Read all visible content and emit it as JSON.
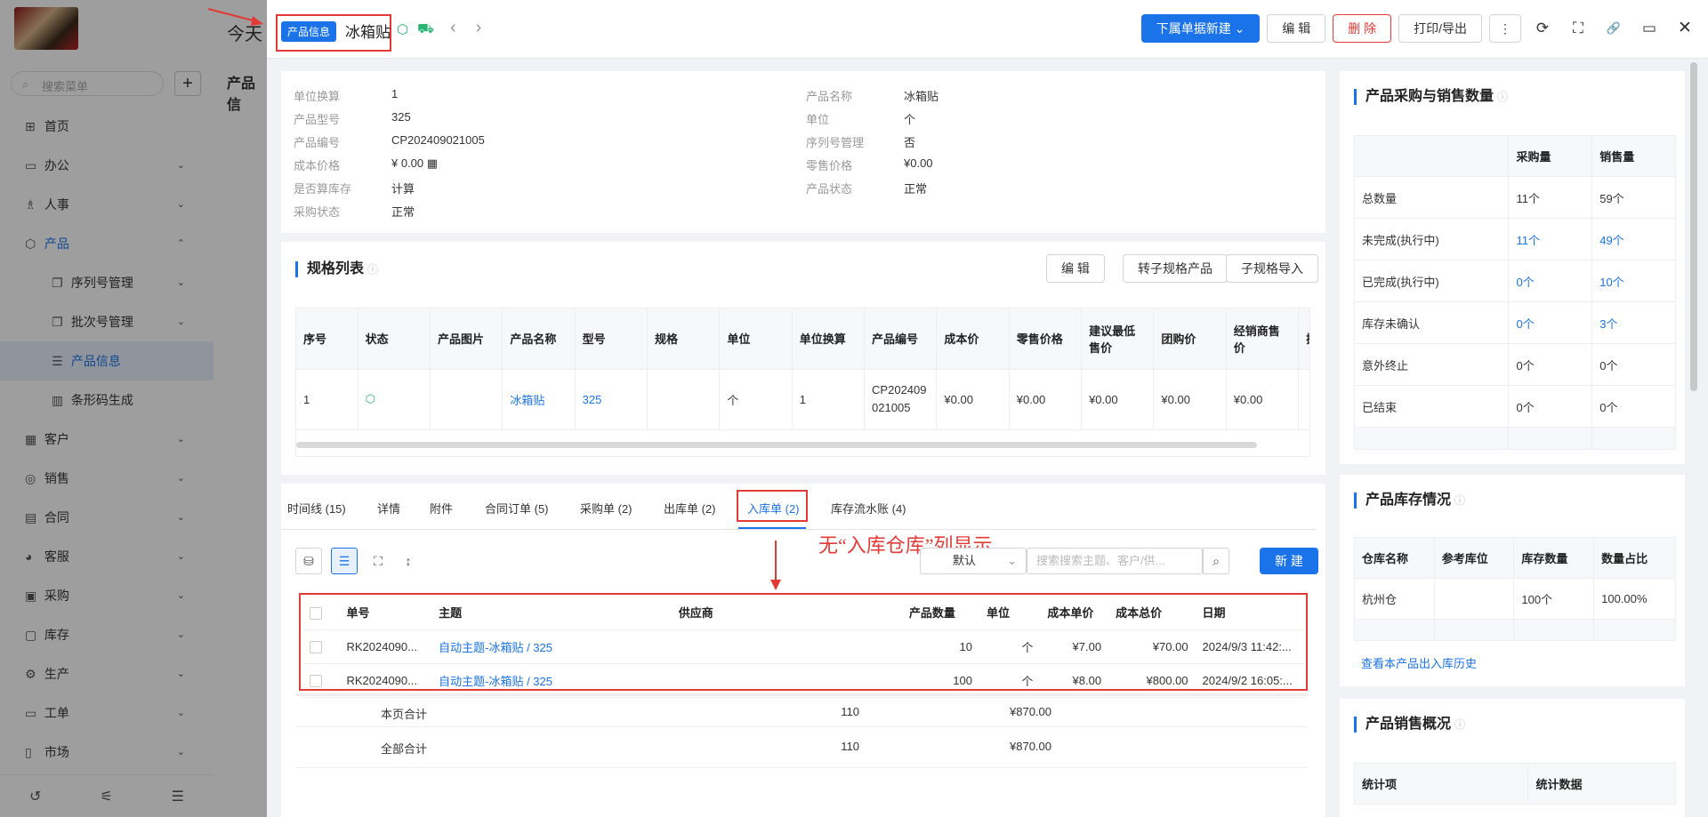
{
  "sidebar": {
    "search_placeholder": "搜索菜单",
    "plus": "+",
    "items": [
      {
        "icon": "⊞",
        "label": "首页"
      },
      {
        "icon": "▭",
        "label": "办公",
        "chev": "⌄"
      },
      {
        "icon": "♗",
        "label": "人事",
        "chev": "⌄"
      },
      {
        "icon": "⬡",
        "label": "产品",
        "chev": "⌃"
      },
      {
        "icon": "❐",
        "label": "序列号管理",
        "chev": "⌄"
      },
      {
        "icon": "❐",
        "label": "批次号管理",
        "chev": "⌄"
      },
      {
        "icon": "☰",
        "label": "产品信息"
      },
      {
        "icon": "▥",
        "label": "条形码生成"
      },
      {
        "icon": "▦",
        "label": "客户",
        "chev": "⌄"
      },
      {
        "icon": "◎",
        "label": "销售",
        "chev": "⌄"
      },
      {
        "icon": "▤",
        "label": "合同",
        "chev": "⌄"
      },
      {
        "icon": "◕",
        "label": "客服",
        "chev": "⌄"
      },
      {
        "icon": "▣",
        "label": "采购",
        "chev": "⌄"
      },
      {
        "icon": "▢",
        "label": "库存",
        "chev": "⌄"
      },
      {
        "icon": "⚙",
        "label": "生产",
        "chev": "⌄"
      },
      {
        "icon": "▭",
        "label": "工单",
        "chev": "⌄"
      },
      {
        "icon": "▯",
        "label": "市场",
        "chev": "⌄"
      }
    ],
    "footer_icons": [
      "↺",
      "⚟",
      "☰"
    ]
  },
  "behind": {
    "greeting": "今天",
    "section": "产品信"
  },
  "topbar": {
    "tag": "产品信息",
    "title": "冰箱贴",
    "icons": [
      "⬡",
      "⛟",
      "‹",
      "›"
    ],
    "btn_new": "下属单据新建 ⌄",
    "btn_edit": "编 辑",
    "btn_delete": "删 除",
    "btn_print": "打印/导出",
    "icon_more": "⋮",
    "icon_refresh": "⟳",
    "icon_fullscreen": "⛶",
    "icon_link": "🔗",
    "icon_window": "▭",
    "icon_close": "✕"
  },
  "info": {
    "left": [
      {
        "k": "单位换算",
        "v": "1"
      },
      {
        "k": "产品型号",
        "v": "325"
      },
      {
        "k": "产品编号",
        "v": "CP202409021005"
      },
      {
        "k": "成本价格",
        "v": "¥ 0.00  ▦"
      },
      {
        "k": "是否算库存",
        "v": "计算"
      },
      {
        "k": "采购状态",
        "v": "正常"
      }
    ],
    "right": [
      {
        "k": "产品名称",
        "v": "冰箱贴"
      },
      {
        "k": "单位",
        "v": "个"
      },
      {
        "k": "序列号管理",
        "v": "否"
      },
      {
        "k": "零售价格",
        "v": "¥0.00"
      },
      {
        "k": "产品状态",
        "v": "正常"
      }
    ]
  },
  "spec": {
    "title": "规格列表",
    "btn_edit": "编 辑",
    "btn_convert": "转子规格产品",
    "btn_import": "子规格导入",
    "headers": [
      "序号",
      "状态",
      "产品图片",
      "产品名称",
      "型号",
      "规格",
      "单位",
      "单位换算",
      "产品编号",
      "成本价",
      "零售价格",
      "建议最低售价",
      "团购价",
      "经销商售价",
      "操"
    ],
    "row": [
      "1",
      "⬡",
      "",
      "冰箱贴",
      "325",
      "",
      "个",
      "1",
      "CP202409021005",
      "¥0.00",
      "¥0.00",
      "¥0.00",
      "¥0.00",
      "¥0.00",
      ""
    ]
  },
  "tabs": [
    "时间线 (15)",
    "详情",
    "附件",
    "合同订单 (5)",
    "采购单 (2)",
    "出库单 (2)",
    "入库单 (2)",
    "库存流水账 (4)"
  ],
  "annotation": "无“入库仓库”列显示",
  "toolbar": {
    "sort_value": "默认",
    "search_placeholder": "搜索搜索主题、客户/供...",
    "btn_new": "新 建"
  },
  "inbound": {
    "headers": [
      "单号",
      "主题",
      "供应商",
      "产品数量",
      "单位",
      "成本单价",
      "成本总价",
      "日期"
    ],
    "rows": [
      [
        "RK2024090...",
        "自动主题-冰箱贴 / 325",
        "",
        "10",
        "个",
        "¥7.00",
        "¥70.00",
        "2024/9/3 11:42:..."
      ],
      [
        "RK2024090...",
        "自动主题-冰箱贴 / 325",
        "",
        "100",
        "个",
        "¥8.00",
        "¥800.00",
        "2024/9/2 16:05:..."
      ]
    ],
    "page_total": {
      "label": "本页合计",
      "qty": "110",
      "amount": "¥870.00"
    },
    "all_total": {
      "label": "全部合计",
      "qty": "110",
      "amount": "¥870.00"
    }
  },
  "purchase_sales": {
    "title": "产品采购与销售数量",
    "headers": [
      "",
      "采购量",
      "销售量"
    ],
    "rows": [
      [
        "总数量",
        "11个",
        "59个"
      ],
      [
        "未完成(执行中)",
        "11个",
        "49个"
      ],
      [
        "已完成(执行中)",
        "0个",
        "10个"
      ],
      [
        "库存未确认",
        "0个",
        "3个"
      ],
      [
        "意外终止",
        "0个",
        "0个"
      ],
      [
        "已结束",
        "0个",
        "0个"
      ]
    ]
  },
  "stock": {
    "title": "产品库存情况",
    "headers": [
      "仓库名称",
      "参考库位",
      "库存数量",
      "数量占比"
    ],
    "row": [
      "杭州仓",
      "",
      "100个",
      "100.00%"
    ],
    "link": "查看本产品出入库历史"
  },
  "sales_overview": {
    "title": "产品销售概况",
    "headers": [
      "统计项",
      "统计数据"
    ]
  }
}
